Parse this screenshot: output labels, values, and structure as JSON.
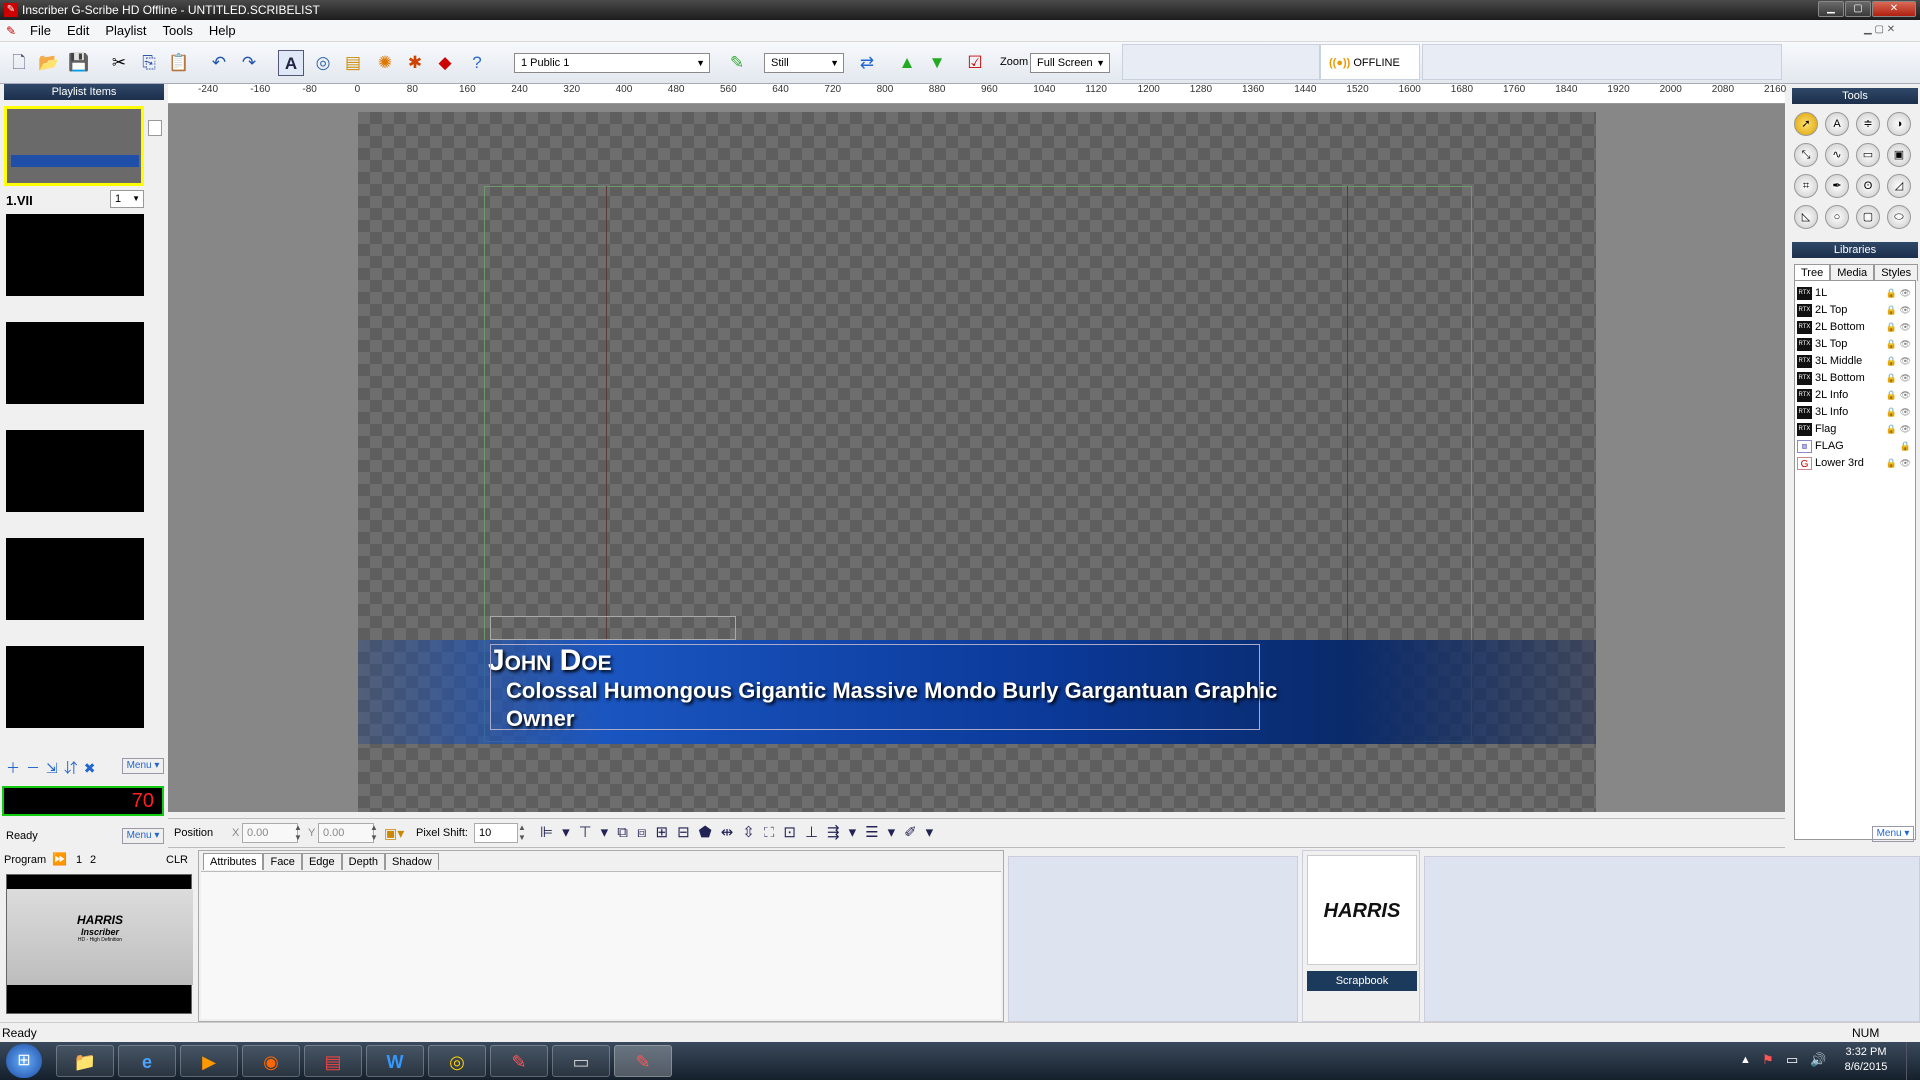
{
  "window": {
    "title": "Inscriber G-Scribe HD Offline - UNTITLED.SCRIBELIST"
  },
  "menu": [
    "File",
    "Edit",
    "Playlist",
    "Tools",
    "Help"
  ],
  "toolbar": {
    "channel_select": "1 Public 1",
    "mode_select": "Still",
    "zoom_label": "Zoom",
    "zoom_select": "Full Screen",
    "offline_label": "OFFLINE"
  },
  "playlist": {
    "header": "Playlist Items",
    "item_name": "1.VII",
    "item_number": "1",
    "menu_label": "Menu",
    "counter": "70",
    "status": "Ready"
  },
  "ruler": {
    "ticks": [
      "-240",
      "-160",
      "-80",
      "0",
      "80",
      "160",
      "240",
      "320",
      "400",
      "480",
      "560",
      "640",
      "720",
      "800",
      "880",
      "960",
      "1040",
      "1120",
      "1200",
      "1280",
      "1360",
      "1440",
      "1520",
      "1600",
      "1680",
      "1760",
      "1840",
      "1920",
      "2000",
      "2080",
      "2160"
    ]
  },
  "graphic": {
    "name": "John Doe",
    "line1": "Colossal Humongous Gigantic Massive Mondo Burly Gargantuan Graphic",
    "line2": "Owner"
  },
  "tools": {
    "header": "Tools",
    "menu_label": "Menu"
  },
  "libraries": {
    "header": "Libraries",
    "tabs": [
      "Tree",
      "Media",
      "Styles"
    ],
    "items": [
      "1L",
      "2L Top",
      "2L Bottom",
      "3L Top",
      "3L Middle",
      "3L Bottom",
      "2L Info",
      "3L Info",
      "Flag",
      "FLAG",
      "Lower 3rd"
    ]
  },
  "midbar": {
    "position_label": "Position",
    "x_label": "X",
    "x_value": "0.00",
    "y_label": "Y",
    "y_value": "0.00",
    "pixel_shift_label": "Pixel Shift:",
    "pixel_shift_value": "10"
  },
  "program": {
    "label": "Program",
    "ch1": "1",
    "ch2": "2",
    "clr": "CLR",
    "brand": "HARRIS",
    "product": "Inscriber",
    "sub": "HD - High Definition"
  },
  "attributes": {
    "tabs": [
      "Attributes",
      "Face",
      "Edge",
      "Depth",
      "Shadow"
    ]
  },
  "scrapbook": {
    "logo": "HARRIS",
    "label": "Scrapbook"
  },
  "statusbar": {
    "left": "Ready",
    "right": "NUM"
  },
  "taskbar": {
    "time": "3:32 PM",
    "date": "8/6/2015"
  },
  "colors": {
    "accent": "#1f5fbf",
    "counter": "#ff2020",
    "title_bg": "#1c1c1c"
  }
}
